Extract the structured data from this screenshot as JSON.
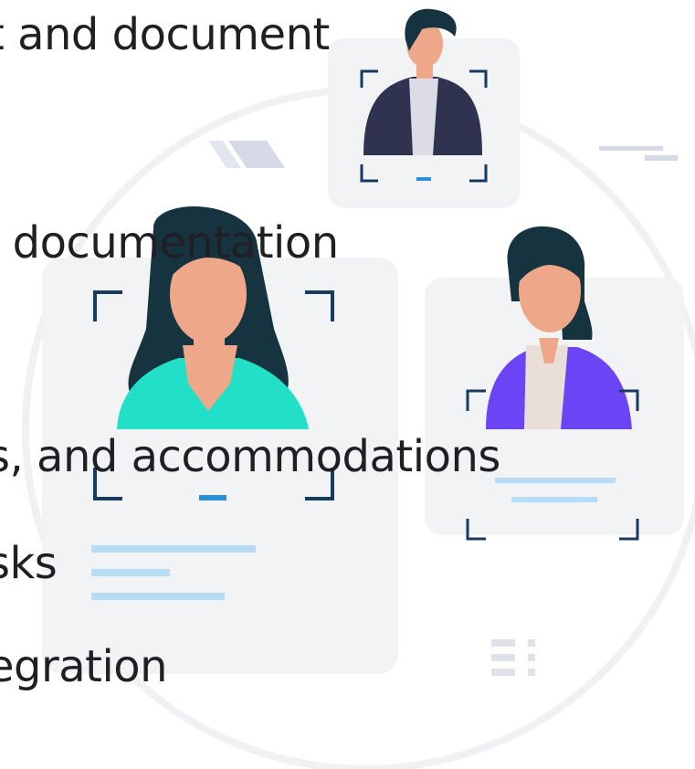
{
  "lines": [
    "t and document",
    "l documentation",
    "s, and accommodations",
    "sks",
    "egration"
  ],
  "colors": {
    "text": "#1f1f24",
    "card_bg": "#f2f3f5",
    "frame": "#173a5e",
    "frame_accent": "#2d8fd5",
    "skin": "#eea889",
    "hair": "#163340",
    "suit": "#2f3350",
    "shirt_light": "#dcdce6",
    "teal_top": "#22e0c8",
    "purple_top": "#6b45f5",
    "placeholder_line": "#b7dcf6",
    "decor_stripe": "#d6d9e6",
    "ring": "#f0f1f3"
  },
  "icons": [
    "man-avatar-icon",
    "woman-long-hair-avatar-icon",
    "woman-short-hair-avatar-icon",
    "scan-frame-icon"
  ]
}
